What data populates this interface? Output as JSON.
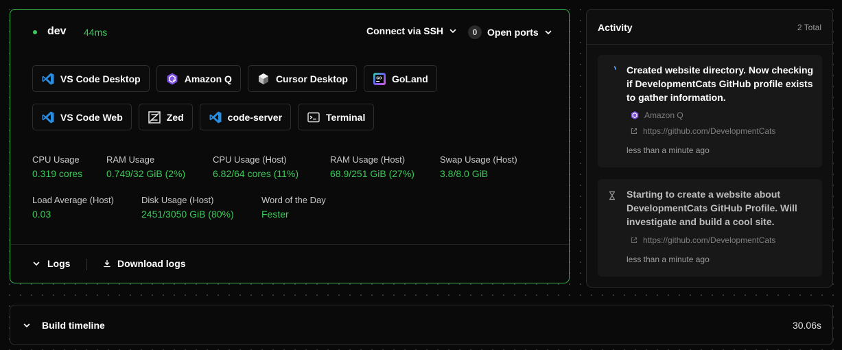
{
  "agent": {
    "name": "dev",
    "latency": "44ms",
    "connect_ssh_label": "Connect via SSH",
    "open_ports_count": "0",
    "open_ports_label": "Open ports",
    "status_color": "#3bc957"
  },
  "apps": [
    {
      "label": "VS Code Desktop",
      "icon": "vscode-icon"
    },
    {
      "label": "Amazon Q",
      "icon": "amazon-q-icon"
    },
    {
      "label": "Cursor Desktop",
      "icon": "cursor-icon"
    },
    {
      "label": "GoLand",
      "icon": "goland-icon"
    },
    {
      "label": "VS Code Web",
      "icon": "vscode-icon"
    },
    {
      "label": "Zed",
      "icon": "zed-icon"
    },
    {
      "label": "code-server",
      "icon": "vscode-icon"
    },
    {
      "label": "Terminal",
      "icon": "terminal-icon"
    }
  ],
  "stats": [
    {
      "label": "CPU Usage",
      "value": "0.319 cores"
    },
    {
      "label": "RAM Usage",
      "value": "0.749/32 GiB (2%)"
    },
    {
      "label": "CPU Usage (Host)",
      "value": "6.82/64 cores (11%)"
    },
    {
      "label": "RAM Usage (Host)",
      "value": "68.9/251 GiB (27%)"
    },
    {
      "label": "Swap Usage (Host)",
      "value": "3.8/8.0 GiB"
    },
    {
      "label": "Load Average (Host)",
      "value": "0.03"
    },
    {
      "label": "Disk Usage (Host)",
      "value": "2451/3050 GiB (80%)"
    },
    {
      "label": "Word of the Day",
      "value": "Fester"
    }
  ],
  "footer": {
    "logs_label": "Logs",
    "download_label": "Download logs"
  },
  "activity": {
    "title": "Activity",
    "total": "2 Total",
    "items": [
      {
        "text": "Created website directory. Now checking if DevelopmentCats GitHub profile exists to gather information.",
        "app": "Amazon Q",
        "link": "https://github.com/DevelopmentCats",
        "time": "less than a minute ago",
        "icon": "spinner-icon"
      },
      {
        "text": "Starting to create a website about DevelopmentCats GitHub Profile. Will investigate and build a cool site.",
        "link": "https://github.com/DevelopmentCats",
        "time": "less than a minute ago",
        "icon": "hourglass-icon"
      }
    ]
  },
  "timeline": {
    "label": "Build timeline",
    "duration": "30.06s"
  }
}
